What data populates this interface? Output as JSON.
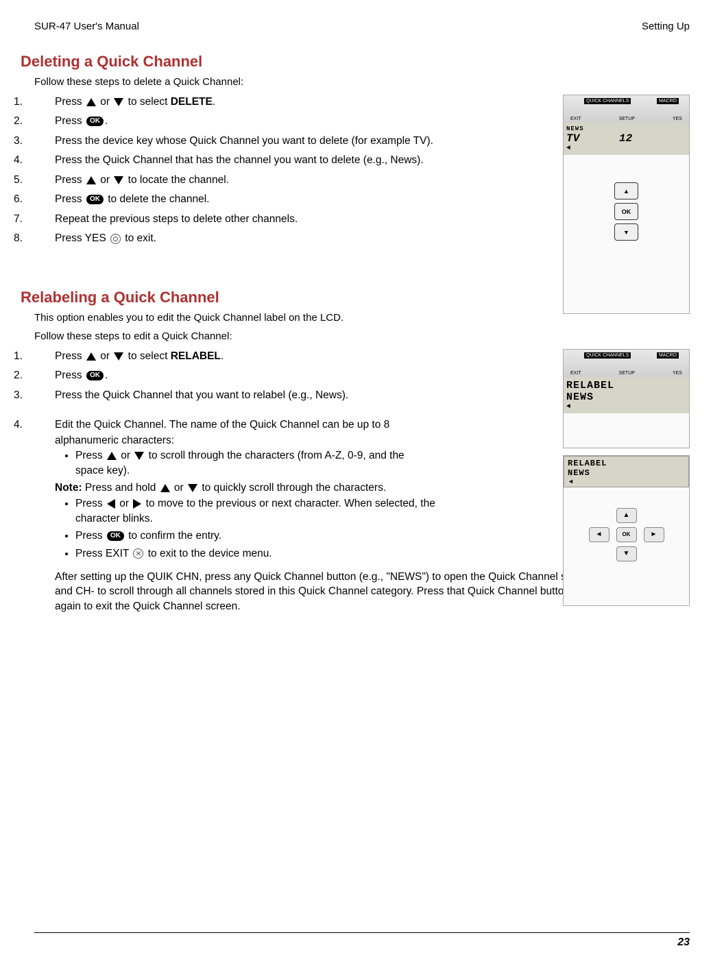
{
  "header": {
    "left": "SUR-47 User's Manual",
    "right": "Setting Up"
  },
  "section1": {
    "title": "Deleting a Quick Channel",
    "intro": "Follow these steps to delete a Quick Channel:",
    "steps": {
      "s1_a": "Press ",
      "s1_b": " or ",
      "s1_c": " to select ",
      "s1_d": "DELETE",
      "s1_e": ".",
      "s2_a": "Press ",
      "s2_b": ".",
      "s3": "Press the device key whose Quick Channel you want to delete (for example TV).",
      "s4": "Press the Quick Channel that has the channel you want to delete (e.g., News).",
      "s5_a": "Press ",
      "s5_b": " or ",
      "s5_c": " to locate the channel.",
      "s6_a": "Press ",
      "s6_b": " to delete the channel.",
      "s7": "Repeat the previous steps to delete other channels.",
      "s8_a": "Press YES ",
      "s8_b": " to exit."
    },
    "device": {
      "qc": "QUICK CHANNELS",
      "macro": "MACRO",
      "exit": "EXIT",
      "setup": "SETUP",
      "yes": "YES",
      "lcd_news": "NEWS",
      "lcd_tv": "TV",
      "lcd_num": "12",
      "ok": "OK"
    }
  },
  "section2": {
    "title": "Relabeling a Quick Channel",
    "intro1": "This option enables you to edit the Quick Channel label on the LCD.",
    "intro2": "Follow these steps to edit a Quick Channel:",
    "steps": {
      "s1_a": "Press ",
      "s1_b": " or ",
      "s1_c": " to select ",
      "s1_d": "RELABEL",
      "s1_e": ".",
      "s2_a": "Press ",
      "s2_b": ".",
      "s3": "Press the Quick Channel that you want to relabel (e.g., News).",
      "s4": "Edit the Quick Channel. The name of the Quick Channel can be up to 8 alphanumeric characters:",
      "b1_a": "Press ",
      "b1_b": " or ",
      "b1_c": " to scroll through the characters (from A-Z, 0-9, and the space key).",
      "note_label": "Note:",
      "note_a": " Press and hold ",
      "note_b": " or ",
      "note_c": " to quickly scroll through the characters.",
      "b2_a": "Press ",
      "b2_b": " or ",
      "b2_c": " to move to the previous or next character. When selected, the character blinks.",
      "b3_a": "Press ",
      "b3_b": " to confirm the entry.",
      "b4_a": "Press EXIT ",
      "b4_b": " to exit to the device menu."
    },
    "device": {
      "qc": "QUICK CHANNELS",
      "macro": "MACRO",
      "exit": "EXIT",
      "setup": "SETUP",
      "yes": "YES",
      "relabel": "RELABEL",
      "news": "NEWS",
      "relabel2": "RELABEL",
      "news2": "NEWS"
    },
    "after": "After setting up the QUIK CHN, press any Quick Channel button (e.g., \"NEWS\") to open the Quick Channel screen.  Use the CH+ and CH- to scroll through all channels stored in this Quick Channel category. Press that Quick Channel button (e.g., \"NEWS\")  again to exit the Quick Channel screen."
  },
  "ok_label": "OK",
  "page_number": "23"
}
